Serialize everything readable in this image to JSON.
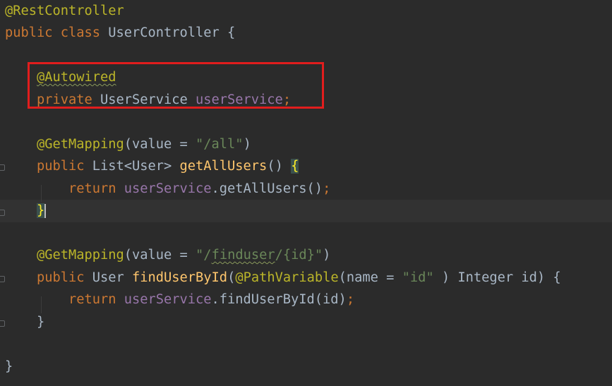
{
  "editor": {
    "lines": [
      {
        "tokens": [
          {
            "t": "@RestController",
            "c": "ann"
          }
        ]
      },
      {
        "tokens": [
          {
            "t": "public ",
            "c": "kw"
          },
          {
            "t": "class ",
            "c": "kw"
          },
          {
            "t": "UserController {",
            "c": "plain"
          }
        ]
      },
      {
        "tokens": []
      },
      {
        "tokens": [
          {
            "t": "    ",
            "c": "plain"
          },
          {
            "t": "@Autowired",
            "c": "ann wavy"
          }
        ]
      },
      {
        "tokens": [
          {
            "t": "    ",
            "c": "plain"
          },
          {
            "t": "private ",
            "c": "kw"
          },
          {
            "t": "UserService ",
            "c": "plain"
          },
          {
            "t": "userService",
            "c": "field"
          },
          {
            "t": ";",
            "c": "kw"
          }
        ]
      },
      {
        "tokens": []
      },
      {
        "tokens": [
          {
            "t": "    ",
            "c": "plain"
          },
          {
            "t": "@GetMapping",
            "c": "ann"
          },
          {
            "t": "(value = ",
            "c": "plain"
          },
          {
            "t": "\"/all\"",
            "c": "str"
          },
          {
            "t": ")",
            "c": "plain"
          }
        ]
      },
      {
        "tokens": [
          {
            "t": "    ",
            "c": "plain"
          },
          {
            "t": "public ",
            "c": "kw"
          },
          {
            "t": "List<User> ",
            "c": "plain"
          },
          {
            "t": "getAllUsers",
            "c": "method"
          },
          {
            "t": "() ",
            "c": "plain"
          },
          {
            "t": "{",
            "c": "brace-hl"
          }
        ]
      },
      {
        "tokens": [
          {
            "t": "        ",
            "c": "plain"
          },
          {
            "t": "return ",
            "c": "kw"
          },
          {
            "t": "userService",
            "c": "field"
          },
          {
            "t": ".getAllUsers()",
            "c": "plain"
          },
          {
            "t": ";",
            "c": "kw"
          }
        ]
      },
      {
        "tokens": [
          {
            "t": "    ",
            "c": "plain"
          },
          {
            "t": "}",
            "c": "brace-hl"
          }
        ],
        "current": true,
        "caret": true
      },
      {
        "tokens": []
      },
      {
        "tokens": [
          {
            "t": "    ",
            "c": "plain"
          },
          {
            "t": "@GetMapping",
            "c": "ann"
          },
          {
            "t": "(value = ",
            "c": "plain"
          },
          {
            "t": "\"/",
            "c": "str"
          },
          {
            "t": "finduser",
            "c": "str wavy"
          },
          {
            "t": "/{id}\"",
            "c": "str"
          },
          {
            "t": ")",
            "c": "plain"
          }
        ]
      },
      {
        "tokens": [
          {
            "t": "    ",
            "c": "plain"
          },
          {
            "t": "public ",
            "c": "kw"
          },
          {
            "t": "User ",
            "c": "plain"
          },
          {
            "t": "findUserById",
            "c": "method"
          },
          {
            "t": "(",
            "c": "plain"
          },
          {
            "t": "@PathVariable",
            "c": "ann"
          },
          {
            "t": "(name = ",
            "c": "plain"
          },
          {
            "t": "\"id\"",
            "c": "str"
          },
          {
            "t": " ) Integer id) {",
            "c": "plain"
          }
        ]
      },
      {
        "tokens": [
          {
            "t": "        ",
            "c": "plain"
          },
          {
            "t": "return ",
            "c": "kw"
          },
          {
            "t": "userService",
            "c": "field"
          },
          {
            "t": ".findUserById(id)",
            "c": "plain"
          },
          {
            "t": ";",
            "c": "kw"
          }
        ]
      },
      {
        "tokens": [
          {
            "t": "    }",
            "c": "plain"
          }
        ]
      },
      {
        "tokens": []
      },
      {
        "tokens": [
          {
            "t": "}",
            "c": "plain"
          }
        ]
      }
    ]
  },
  "colors": {
    "background": "#2b2b2b",
    "highlight_box": "#e11d1d",
    "annotation": "#bbb529",
    "keyword": "#cc7832",
    "field": "#9876aa",
    "string": "#6a8759",
    "method": "#ffc66d",
    "plain": "#a9b7c6"
  }
}
